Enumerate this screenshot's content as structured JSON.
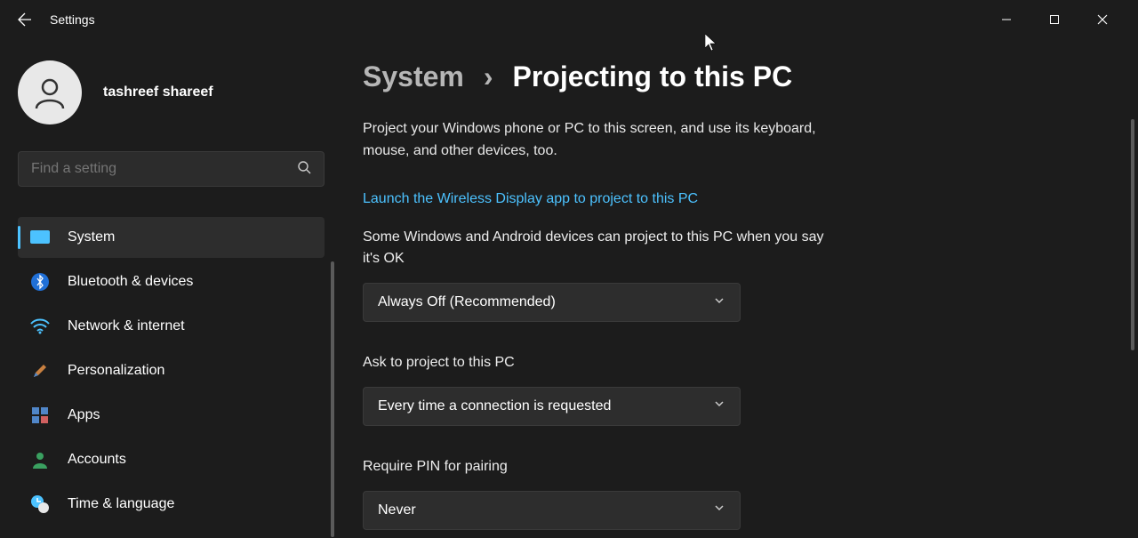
{
  "window": {
    "title": "Settings"
  },
  "user": {
    "name": "tashreef shareef"
  },
  "search": {
    "placeholder": "Find a setting"
  },
  "sidebar": {
    "items": [
      {
        "label": "System"
      },
      {
        "label": "Bluetooth & devices"
      },
      {
        "label": "Network & internet"
      },
      {
        "label": "Personalization"
      },
      {
        "label": "Apps"
      },
      {
        "label": "Accounts"
      },
      {
        "label": "Time & language"
      }
    ]
  },
  "breadcrumb": {
    "parent": "System",
    "current": "Projecting to this PC"
  },
  "page": {
    "description": "Project your Windows phone or PC to this screen, and use its keyboard, mouse, and other devices, too.",
    "link": "Launch the Wireless Display app to project to this PC",
    "setting1": {
      "label": "Some Windows and Android devices can project to this PC when you say it's OK",
      "value": "Always Off (Recommended)"
    },
    "setting2": {
      "label": "Ask to project to this PC",
      "value": "Every time a connection is requested"
    },
    "setting3": {
      "label": "Require PIN for pairing",
      "value": "Never"
    }
  }
}
